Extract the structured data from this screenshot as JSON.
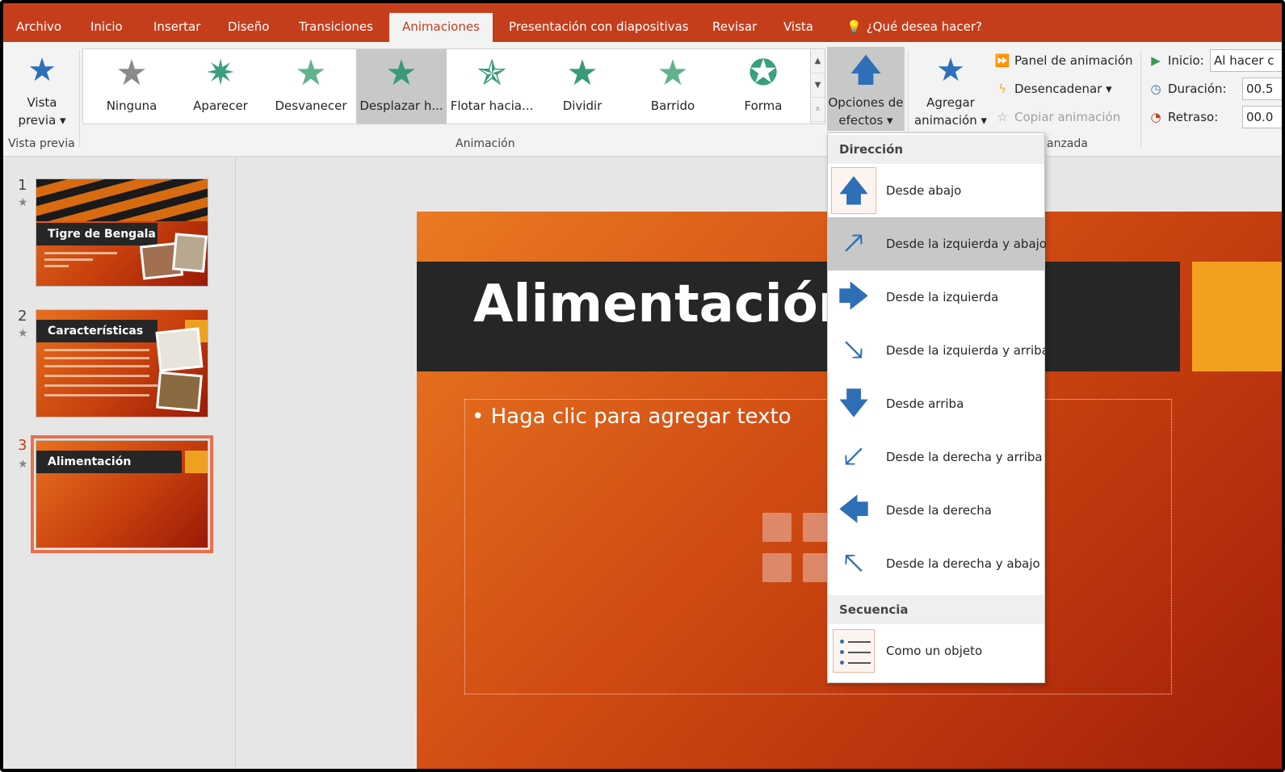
{
  "tabs": [
    "Archivo",
    "Inicio",
    "Insertar",
    "Diseño",
    "Transiciones",
    "Animaciones",
    "Presentación con diapositivas",
    "Revisar",
    "Vista"
  ],
  "active_tab": "Animaciones",
  "tell_me": "¿Qué desea hacer?",
  "ribbon": {
    "preview_label_1": "Vista",
    "preview_label_2": "previa ▾",
    "preview_group": "Vista previa",
    "animation_group": "Animación",
    "advanced_group_partial": "anzada",
    "gallery": [
      "Ninguna",
      "Aparecer",
      "Desvanecer",
      "Desplazar h...",
      "Flotar hacia...",
      "Dividir",
      "Barrido",
      "Forma"
    ],
    "gallery_selected": "Desplazar h...",
    "effect_options_1": "Opciones de",
    "effect_options_2": "efectos ▾",
    "add_animation_1": "Agregar",
    "add_animation_2": "animación ▾",
    "animation_pane": "Panel de animación",
    "trigger": "Desencadenar ▾",
    "copy_animation": "Copiar animación",
    "start_label": "Inicio:",
    "start_value": "Al hacer c",
    "duration_label": "Duración:",
    "duration_value": "00.5",
    "delay_label": "Retraso:",
    "delay_value": "00.0"
  },
  "thumbnails": [
    {
      "num": "1",
      "title": "Tigre de Bengala"
    },
    {
      "num": "2",
      "title": "Características"
    },
    {
      "num": "3",
      "title": "Alimentación"
    }
  ],
  "slide": {
    "title": "Alimentación",
    "content_placeholder": "• Haga clic para agregar texto"
  },
  "menu": {
    "direction_header": "Dirección",
    "items": [
      {
        "icon": "arrow-up-icon",
        "label": "Desde abajo"
      },
      {
        "icon": "arrow-up-right-icon",
        "label": "Desde la izquierda y abajo"
      },
      {
        "icon": "arrow-right-icon",
        "label": "Desde la izquierda"
      },
      {
        "icon": "arrow-down-right-icon",
        "label": "Desde la izquierda y arriba"
      },
      {
        "icon": "arrow-down-icon",
        "label": "Desde arriba"
      },
      {
        "icon": "arrow-down-left-icon",
        "label": "Desde la derecha y arriba"
      },
      {
        "icon": "arrow-left-icon",
        "label": "Desde la derecha"
      },
      {
        "icon": "arrow-up-left-icon",
        "label": "Desde la derecha y abajo"
      }
    ],
    "hovered_index": 1,
    "sequence_header": "Secuencia",
    "sequence_item": "Como un objeto"
  },
  "colors": {
    "accent": "#c43e1c",
    "arrow_blue": "#2e6fb7",
    "slide_orange": "#d04a12",
    "title_bar": "#262626",
    "accent_square": "#f2a020"
  }
}
